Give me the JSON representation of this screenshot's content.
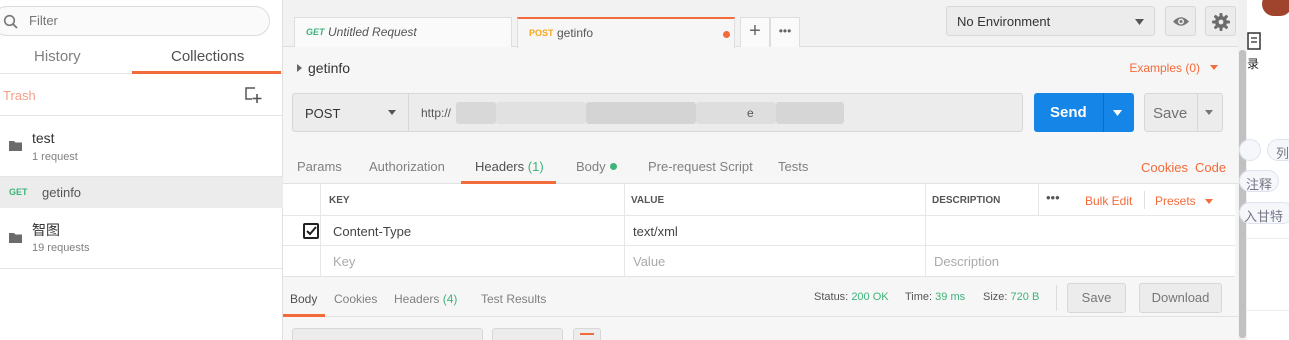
{
  "sidebar": {
    "filter_placeholder": "Filter",
    "tabs": [
      "History",
      "Collections"
    ],
    "trash_label": "Trash",
    "collections": [
      {
        "name": "test",
        "count": "1 request"
      },
      {
        "name": "智图",
        "count": "19 requests"
      }
    ],
    "request": {
      "method": "GET",
      "name": "getinfo"
    }
  },
  "tabs": [
    {
      "method": "GET",
      "title": "Untitled Request"
    },
    {
      "method": "POST",
      "title": "getinfo"
    }
  ],
  "tab_actions": {
    "new": "+",
    "more": "•••"
  },
  "environment": {
    "selected": "No Environment"
  },
  "request": {
    "breadcrumb": "getinfo",
    "examples": "Examples (0)",
    "method": "POST",
    "url_prefix": "http://",
    "url_suffix": "e",
    "send_label": "Send",
    "save_label": "Save"
  },
  "request_tabs": {
    "params": "Params",
    "authorization": "Authorization",
    "headers": "Headers",
    "headers_count": "(1)",
    "body": "Body",
    "prerequest": "Pre-request Script",
    "tests": "Tests",
    "cookies": "Cookies",
    "code": "Code"
  },
  "headers_table": {
    "columns": {
      "key": "KEY",
      "value": "VALUE",
      "description": "DESCRIPTION"
    },
    "more": "•••",
    "bulk_edit": "Bulk Edit",
    "presets": "Presets",
    "rows": [
      {
        "key": "Content-Type",
        "value": "text/xml",
        "description": "",
        "checked": true
      }
    ],
    "placeholder": {
      "key": "Key",
      "value": "Value",
      "description": "Description"
    }
  },
  "response": {
    "tabs": {
      "body": "Body",
      "cookies": "Cookies",
      "headers": "Headers",
      "headers_count": "(4)",
      "test_results": "Test Results"
    },
    "status_label": "Status:",
    "status_value": "200 OK",
    "time_label": "Time:",
    "time_value": "39 ms",
    "size_label": "Size:",
    "size_value": "720 B",
    "save_label": "Save",
    "download_label": "Download"
  },
  "right_panel": {
    "texts": [
      "录",
      "列",
      "注释",
      "入甘特"
    ]
  },
  "colors": {
    "accent": "#f26b3a",
    "send": "#1585e8",
    "get_method": "#3eb37a",
    "post_method": "#f6a623",
    "success": "#3eb37a"
  }
}
